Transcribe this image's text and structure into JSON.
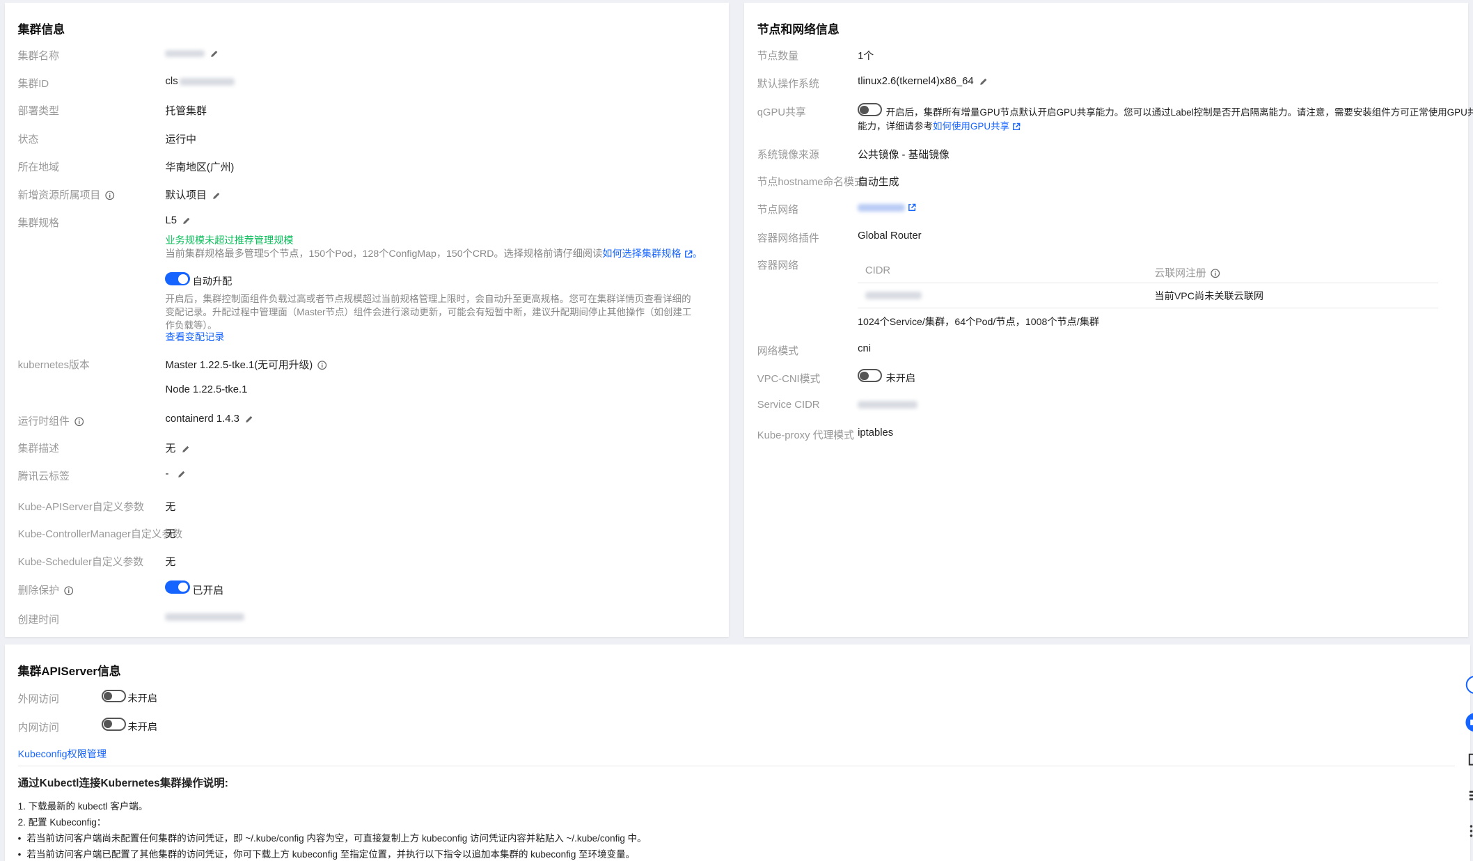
{
  "cluster_info": {
    "title": "集群信息",
    "name_label": "集群名称",
    "id_label": "集群ID",
    "id_prefix": "cls",
    "deploy_type_label": "部署类型",
    "deploy_type": "托管集群",
    "status_label": "状态",
    "status": "运行中",
    "region_label": "所在地域",
    "region": "华南地区(广州)",
    "project_label": "新增资源所属项目",
    "project": "默认项目",
    "spec_label": "集群规格",
    "spec": "L5",
    "spec_ok": "业务规模未超过推荐管理规模",
    "spec_desc": "当前集群规格最多管理5个节点，150个Pod，128个ConfigMap，150个CRD。选择规格前请仔细阅读",
    "spec_link": "如何选择集群规格",
    "spec_end": "。",
    "auto_upgrade_label": "自动升配",
    "auto_upgrade_desc": "开启后，集群控制面组件负载过高或者节点规模超过当前规格管理上限时，会自动升至更高规格。您可在集群详情页查看详细的变配记录。升配过程中管理面（Master节点）组件会进行滚动更新，可能会有短暂中断，建议升配期间停止其他操作（如创建工作负载等）。",
    "change_log_link": "查看变配记录",
    "k8s_label": "kubernetes版本",
    "k8s_master": "Master 1.22.5-tke.1(无可用升级)",
    "k8s_node": "Node 1.22.5-tke.1",
    "runtime_label": "运行时组件",
    "runtime": "containerd 1.4.3",
    "desc_label": "集群描述",
    "desc": "无",
    "tags_label": "腾讯云标签",
    "tags": "-",
    "apiserver_params_label": "Kube-APIServer自定义参数",
    "apiserver_params": "无",
    "controller_params_label": "Kube-ControllerManager自定义参数",
    "controller_params": "无",
    "scheduler_params_label": "Kube-Scheduler自定义参数",
    "scheduler_params": "无",
    "delete_protect_label": "删除保护",
    "delete_protect": "已开启",
    "created_label": "创建时间"
  },
  "node_network": {
    "title": "节点和网络信息",
    "node_count_label": "节点数量",
    "node_count": "1个",
    "os_label": "默认操作系统",
    "os": "tlinux2.6(tkernel4)x86_64",
    "qgpu_label": "qGPU共享",
    "qgpu_desc": "开启后，集群所有增量GPU节点默认开启GPU共享能力。您可以通过Label控制是否开启隔离能力。请注意，需要安装组件方可正常使用GPU共享调度",
    "qgpu_desc2": "能力，详细请参考",
    "qgpu_link": "如何使用GPU共享",
    "image_src_label": "系统镜像来源",
    "image_src": "公共镜像 - 基础镜像",
    "hostname_label": "节点hostname命名模式",
    "hostname": "自动生成",
    "node_net_label": "节点网络",
    "cni_plugin_label": "容器网络插件",
    "cni_plugin": "Global Router",
    "container_net_label": "容器网络",
    "cidr_header": "CIDR",
    "ccn_header": "云联网注册",
    "ccn_value": "当前VPC尚未关联云联网",
    "capacity": "1024个Service/集群，64个Pod/节点，1008个节点/集群",
    "net_mode_label": "网络模式",
    "net_mode": "cni",
    "vpc_cni_label": "VPC-CNI模式",
    "vpc_cni": "未开启",
    "service_cidr_label": "Service CIDR",
    "kube_proxy_label": "Kube-proxy 代理模式",
    "kube_proxy": "iptables"
  },
  "apiserver": {
    "title": "集群APIServer信息",
    "external_label": "外网访问",
    "external": "未开启",
    "internal_label": "内网访问",
    "internal": "未开启",
    "kubeconfig_link": "Kubeconfig权限管理",
    "guide_title": "通过Kubectl连接Kubernetes集群操作说明:",
    "step1": "1. 下载最新的 kubectl 客户端。",
    "step2": "2. 配置 Kubeconfig：",
    "bullet1": "若当前访问客户端尚未配置任何集群的访问凭证，即 ~/.kube/config 内容为空，可直接复制上方 kubeconfig 访问凭证内容并粘贴入 ~/.kube/config 中。",
    "bullet2": "若当前访问客户端已配置了其他集群的访问凭证，你可下载上方 kubeconfig 至指定位置，并执行以下指令以追加本集群的 kubeconfig 至环境变量。"
  },
  "colors": {
    "accent": "#1664ff",
    "success": "#0abf5b",
    "label": "#999999"
  }
}
